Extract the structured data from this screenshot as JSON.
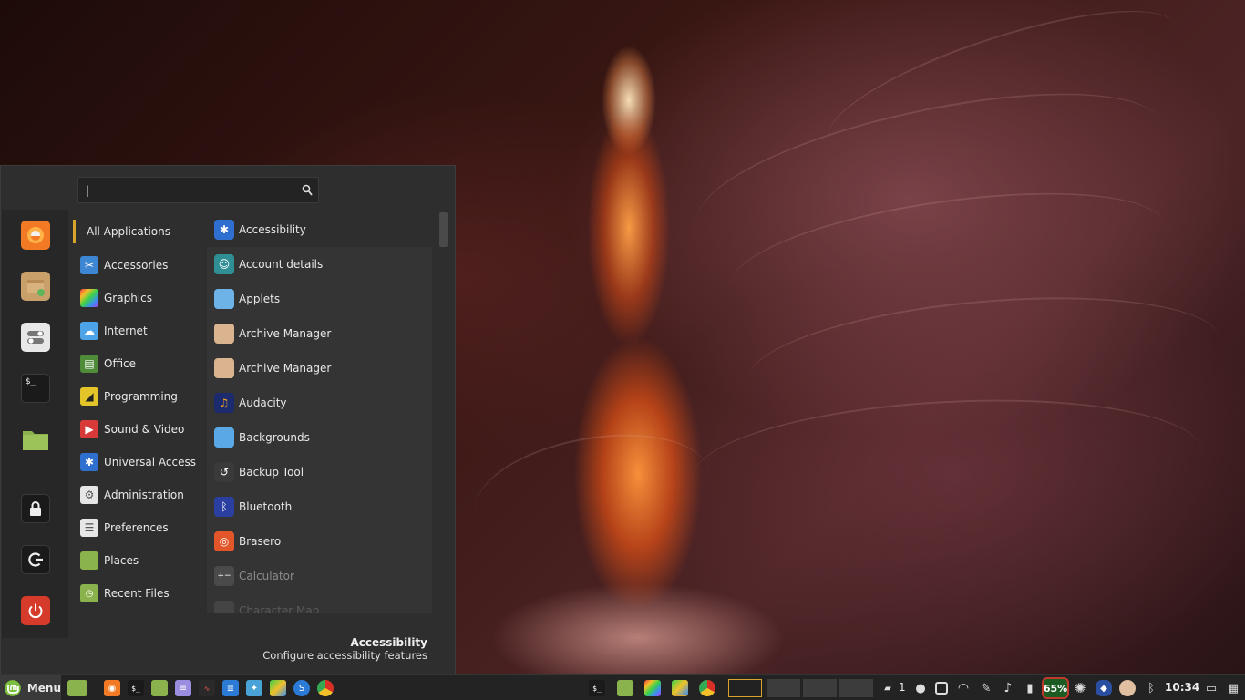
{
  "search": {
    "value": "",
    "placeholder": "|"
  },
  "favorites": [
    {
      "name": "firefox-icon",
      "color": "#f27a24"
    },
    {
      "name": "package-installer-icon",
      "color": "#c9a06a"
    },
    {
      "name": "settings-toggle-icon",
      "color": "#e8e8e8"
    },
    {
      "name": "terminal-icon",
      "color": "#1a1a1a"
    },
    {
      "name": "folder-icon",
      "color": "#8bb34d"
    },
    {
      "name": "lock-icon",
      "color": "#1a1a1a"
    },
    {
      "name": "logout-icon",
      "color": "#1a1a1a"
    },
    {
      "name": "power-icon",
      "color": "#d63a2a"
    }
  ],
  "categories": [
    {
      "label": "All Applications"
    },
    {
      "label": "Accessories",
      "icon": "accessories-icon",
      "color": "#3d86d4"
    },
    {
      "label": "Graphics",
      "icon": "graphics-icon",
      "color": "#c94fd1"
    },
    {
      "label": "Internet",
      "icon": "internet-icon",
      "color": "#4ca3e8"
    },
    {
      "label": "Office",
      "icon": "office-icon",
      "color": "#4e8c3a"
    },
    {
      "label": "Programming",
      "icon": "programming-icon",
      "color": "#e3c52a"
    },
    {
      "label": "Sound & Video",
      "icon": "sound-video-icon",
      "color": "#d83a3a"
    },
    {
      "label": "Universal Access",
      "icon": "universal-access-icon",
      "color": "#2f6fd0"
    },
    {
      "label": "Administration",
      "icon": "administration-icon",
      "color": "#e6e6e6"
    },
    {
      "label": "Preferences",
      "icon": "preferences-icon",
      "color": "#e6e6e6"
    },
    {
      "label": "Places",
      "icon": "places-icon",
      "color": "#8bb34d"
    },
    {
      "label": "Recent Files",
      "icon": "recent-files-icon",
      "color": "#8bb34d"
    }
  ],
  "apps": [
    {
      "label": "Accessibility",
      "icon": "accessibility-icon",
      "color": "#2f6fd0"
    },
    {
      "label": "Account details",
      "icon": "account-details-icon",
      "color": "#2f8f95"
    },
    {
      "label": "Applets",
      "icon": "applets-icon",
      "color": "#6db3e8"
    },
    {
      "label": "Archive Manager",
      "icon": "archive-manager-icon",
      "color": "#d9b48e"
    },
    {
      "label": "Archive Manager",
      "icon": "archive-manager-icon",
      "color": "#d9b48e"
    },
    {
      "label": "Audacity",
      "icon": "audacity-icon",
      "color": "#1c2a6e"
    },
    {
      "label": "Backgrounds",
      "icon": "backgrounds-icon",
      "color": "#5aa9e6"
    },
    {
      "label": "Backup Tool",
      "icon": "backup-tool-icon",
      "color": "#3a3a3a"
    },
    {
      "label": "Bluetooth",
      "icon": "bluetooth-icon",
      "color": "#2b3fa0"
    },
    {
      "label": "Brasero",
      "icon": "brasero-icon",
      "color": "#e2562a"
    },
    {
      "label": "Calculator",
      "icon": "calculator-icon",
      "color": "#4a4a4a"
    },
    {
      "label": "Character Map",
      "icon": "character-map-icon",
      "color": "#4a4a4a"
    }
  ],
  "description": {
    "title": "Accessibility",
    "text": "Configure accessibility features"
  },
  "taskbar": {
    "menu_label": "Menu",
    "notification_count": "1",
    "battery": "65%",
    "clock": "10:34"
  }
}
